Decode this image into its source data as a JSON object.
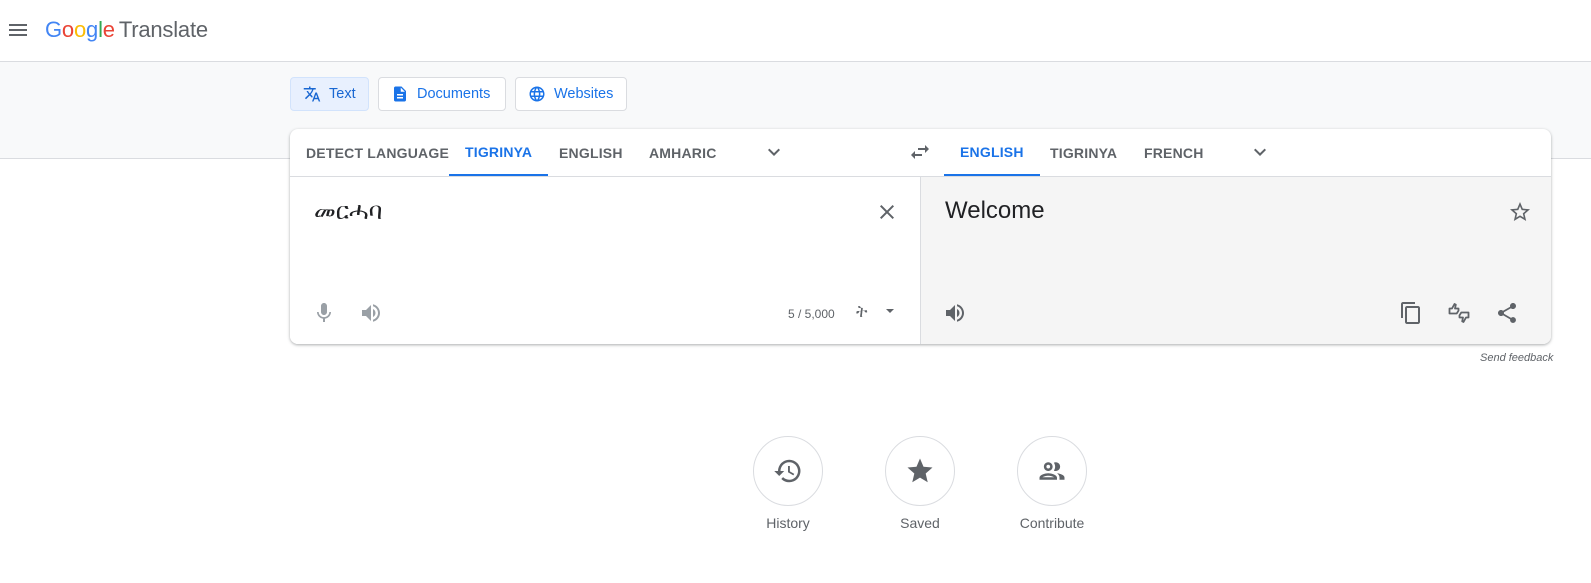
{
  "header": {
    "logo_letters": [
      "G",
      "o",
      "o",
      "g",
      "l",
      "e"
    ],
    "product": "Translate"
  },
  "modes": [
    {
      "label": "Text",
      "icon": "translate-icon",
      "active": true
    },
    {
      "label": "Documents",
      "icon": "document-icon",
      "active": false
    },
    {
      "label": "Websites",
      "icon": "globe-icon",
      "active": false
    }
  ],
  "source": {
    "tabs": [
      "DETECT LANGUAGE",
      "TIGRINYA",
      "ENGLISH",
      "AMHARIC"
    ],
    "active_tab": "TIGRINYA",
    "text": "መርሓባ",
    "char_count": "5 / 5,000",
    "ime_glyph": "ት"
  },
  "target": {
    "tabs": [
      "ENGLISH",
      "TIGRINYA",
      "FRENCH"
    ],
    "active_tab": "ENGLISH",
    "text": "Welcome"
  },
  "feedback_label": "Send feedback",
  "bottom": [
    {
      "label": "History",
      "icon": "history-icon"
    },
    {
      "label": "Saved",
      "icon": "star-icon"
    },
    {
      "label": "Contribute",
      "icon": "people-icon"
    }
  ],
  "colors": {
    "accent": "#1a73e8",
    "active_bg": "#e8f0fe",
    "target_bg": "#f5f5f5",
    "band_bg": "#f8f9fa"
  }
}
